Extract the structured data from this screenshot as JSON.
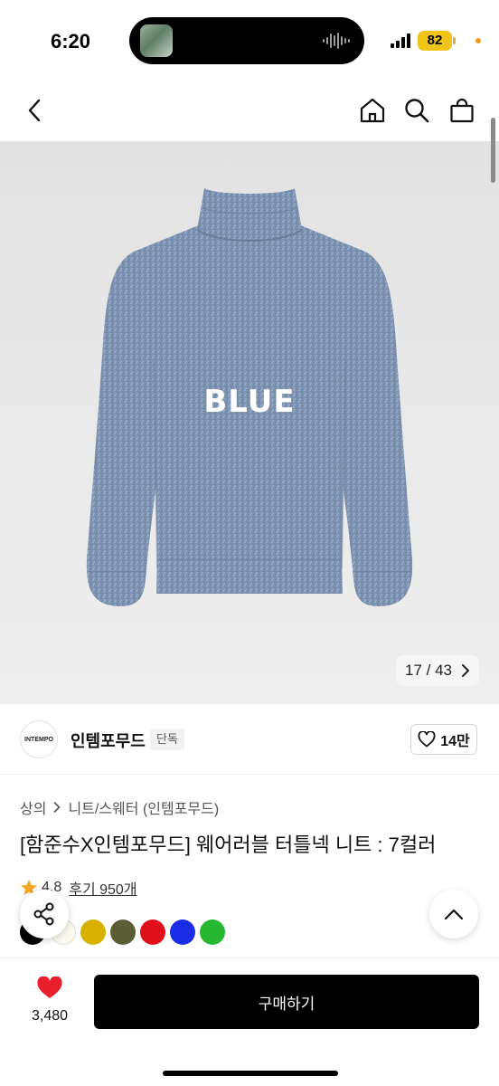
{
  "status_bar": {
    "time": "6:20",
    "battery": "82",
    "battery_color": "#f0c419"
  },
  "nav": {
    "back_icon": "chevron-left-icon",
    "home_icon": "home-icon",
    "search_icon": "search-icon",
    "cart_icon": "shopping-bag-icon"
  },
  "hero": {
    "color_label": "BLUE",
    "counter": "17 / 43",
    "sweater_color": "#7f95b3"
  },
  "brand": {
    "logo_text": "INTEMPO",
    "name": "인템포무드",
    "badge": "단독",
    "likes": "14만"
  },
  "product": {
    "breadcrumb": [
      "상의",
      "니트/스웨터 (인템포무드)"
    ],
    "title": "[함준수X인템포무드] 웨어러블 터틀넥 니트 : 7컬러",
    "rating": "4.8",
    "reviews": "후기 950개",
    "swatches": [
      "#000000",
      "#fbf8ee",
      "#d8b200",
      "#5b5e35",
      "#e0101a",
      "#1a2ce6",
      "#27b832"
    ]
  },
  "bottom_bar": {
    "wish_count": "3,480",
    "buy_label": "구매하기",
    "heart_color": "#e8202c"
  }
}
